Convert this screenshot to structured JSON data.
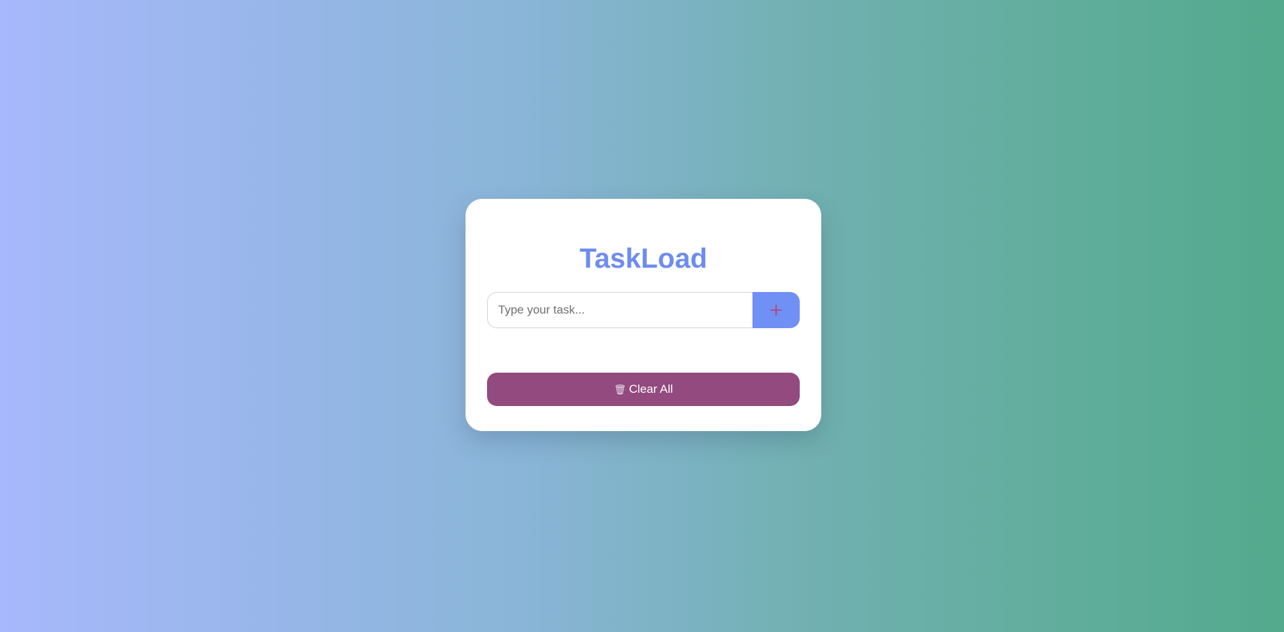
{
  "app": {
    "title": "TaskLoad"
  },
  "task_input": {
    "value": "",
    "placeholder": "Type your task..."
  },
  "add_button": {
    "icon": "plus-icon"
  },
  "tasks": [],
  "clear_button": {
    "icon": "trash-icon",
    "icon_glyph": "🗑",
    "label": "Clear All"
  },
  "colors": {
    "accent": "#6e8cf0",
    "add_button_bg": "#7090f5",
    "clear_button_bg": "#924a7f",
    "gradient_start": "#a7b8fc",
    "gradient_end": "#53aa8c"
  }
}
